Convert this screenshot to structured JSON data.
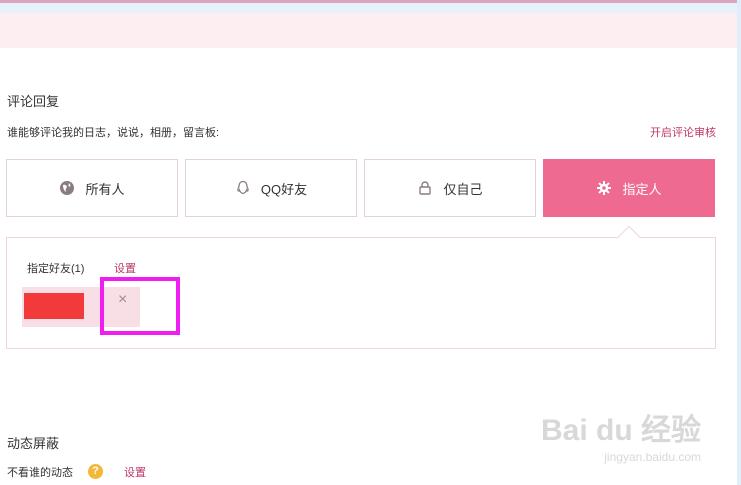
{
  "comment_reply": {
    "title": "评论回复",
    "question": "谁能够评论我的日志，说说，相册，留言板:",
    "review_link": "开启评论审核"
  },
  "options": [
    {
      "label": "所有人",
      "icon": "globe-icon"
    },
    {
      "label": "QQ好友",
      "icon": "qq-icon"
    },
    {
      "label": "仅自己",
      "icon": "lock-icon"
    },
    {
      "label": "指定人",
      "icon": "gear-icon",
      "selected": true
    }
  ],
  "specified": {
    "label": "指定好友(1)",
    "settings_link": "设置",
    "remove_symbol": "×"
  },
  "feed_shield": {
    "title": "动态屏蔽",
    "label": "不看谁的动态",
    "help_symbol": "?",
    "settings_link": "设置"
  },
  "watermark": {
    "brand": "Bai du 经验",
    "url": "jingyan.baidu.com"
  },
  "colors": {
    "accent": "#ef6a91",
    "link": "#c0376a",
    "highlight": "#f01df0"
  }
}
